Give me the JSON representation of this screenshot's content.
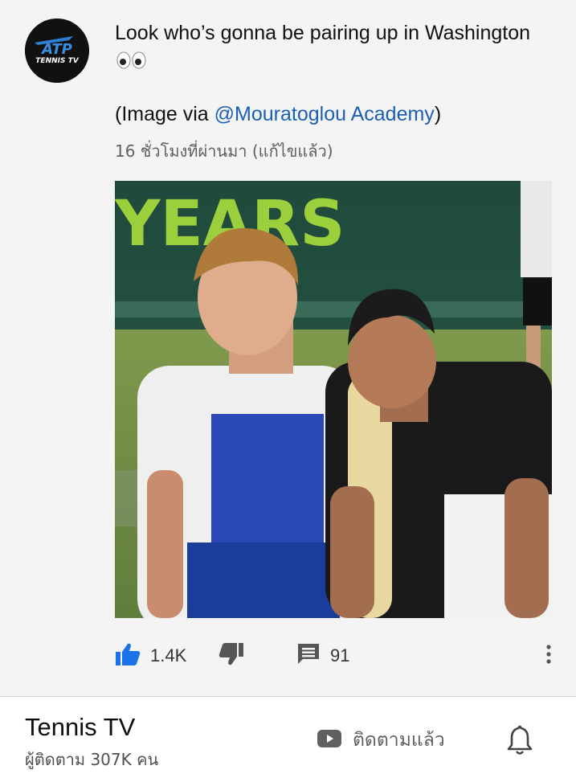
{
  "post": {
    "channel_logo_text": "ATP TENNIS TV",
    "text_line1": "Look who’s gonna be pairing up in Washington",
    "text_prefix": "(Image via ",
    "mention": "@Mouratoglou Academy",
    "text_suffix": ")",
    "timestamp": "16 ชั่วโมงที่ผ่านมา (แก้ไขแล้ว)",
    "image_sign_text": "YEARS"
  },
  "actions": {
    "like_icon": "thumbs-up-icon",
    "like_count": "1.4K",
    "dislike_icon": "thumbs-down-icon",
    "comment_icon": "comment-icon",
    "comment_count": "91",
    "more_icon": "more-vert-icon"
  },
  "channel": {
    "name": "Tennis TV",
    "subscribers": "ผู้ติดตาม 307K คน",
    "subscribed_label": "ติดตามแล้ว",
    "subscribed_icon": "youtube-icon",
    "bell_icon": "bell-icon"
  },
  "colors": {
    "like_active": "#1a73e8",
    "mention": "#1a5fb4",
    "icon_gray": "#555555"
  }
}
